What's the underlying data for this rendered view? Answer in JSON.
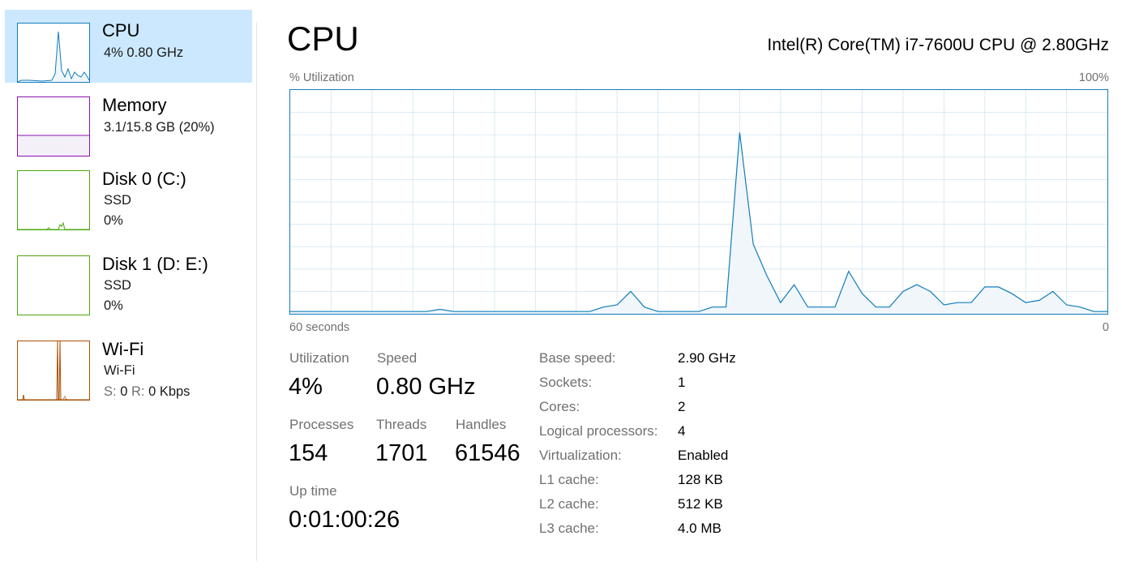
{
  "sidebar": {
    "items": [
      {
        "title": "CPU",
        "line1": "4%  0.80 GHz",
        "color": "#117dbb",
        "selected": true
      },
      {
        "title": "Memory",
        "line1": "3.1/15.8 GB (20%)",
        "color": "#8b12ae"
      },
      {
        "title": "Disk 0 (C:)",
        "line1": "SSD",
        "line2": "0%",
        "color": "#4da60c"
      },
      {
        "title": "Disk 1 (D: E:)",
        "line1": "SSD",
        "line2": "0%",
        "color": "#4da60c"
      },
      {
        "title": "Wi-Fi",
        "line1": "Wi-Fi",
        "send_label": "S:",
        "send_value": "0",
        "recv_label": "R:",
        "recv_value": "0 Kbps",
        "color": "#a74f01"
      }
    ]
  },
  "main": {
    "title": "CPU",
    "model": "Intel(R) Core(TM) i7-7600U CPU @ 2.80GHz",
    "graph": {
      "top_left_label": "% Utilization",
      "top_right_label": "100%",
      "bottom_left_label": "60 seconds",
      "bottom_right_label": "0"
    },
    "stats": {
      "utilization_label": "Utilization",
      "utilization_value": "4%",
      "speed_label": "Speed",
      "speed_value": "0.80 GHz",
      "processes_label": "Processes",
      "processes_value": "154",
      "threads_label": "Threads",
      "threads_value": "1701",
      "handles_label": "Handles",
      "handles_value": "61546",
      "uptime_label": "Up time",
      "uptime_value": "0:01:00:26"
    },
    "specs": [
      {
        "label": "Base speed:",
        "value": "2.90 GHz"
      },
      {
        "label": "Sockets:",
        "value": "1"
      },
      {
        "label": "Cores:",
        "value": "2"
      },
      {
        "label": "Logical processors:",
        "value": "4"
      },
      {
        "label": "Virtualization:",
        "value": "Enabled"
      },
      {
        "label": "L1 cache:",
        "value": "128 KB"
      },
      {
        "label": "L2 cache:",
        "value": "512 KB"
      },
      {
        "label": "L3 cache:",
        "value": "4.0 MB"
      }
    ]
  },
  "chart_data": {
    "type": "area",
    "x_unit": "seconds",
    "y_unit": "% utilization",
    "xlim": [
      60,
      0
    ],
    "ylim": [
      0,
      100
    ],
    "grid": true,
    "color": "#117dbb",
    "x": [
      60,
      59,
      58,
      57,
      56,
      55,
      54,
      53,
      52,
      51,
      50,
      49,
      48,
      47,
      46,
      45,
      44,
      43,
      42,
      41,
      40,
      39,
      38,
      37,
      36,
      35,
      34,
      33,
      32,
      31,
      30,
      29,
      28,
      27,
      26,
      25,
      24,
      23,
      22,
      21,
      20,
      19,
      18,
      17,
      16,
      15,
      14,
      13,
      12,
      11,
      10,
      9,
      8,
      7,
      6,
      5,
      4,
      3,
      2,
      1,
      0
    ],
    "values": [
      1,
      1,
      1,
      1,
      1,
      1,
      1,
      1,
      1,
      1,
      1,
      2,
      1,
      1,
      1,
      1,
      1,
      1,
      1,
      1,
      1,
      1,
      1,
      3,
      4,
      10,
      3,
      1,
      1,
      1,
      1,
      3,
      3,
      81,
      31,
      17,
      5,
      13,
      3,
      3,
      3,
      19,
      9,
      3,
      3,
      10,
      13,
      10,
      4,
      5,
      5,
      12,
      12,
      9,
      5,
      6,
      10,
      4,
      3,
      1,
      1
    ]
  }
}
